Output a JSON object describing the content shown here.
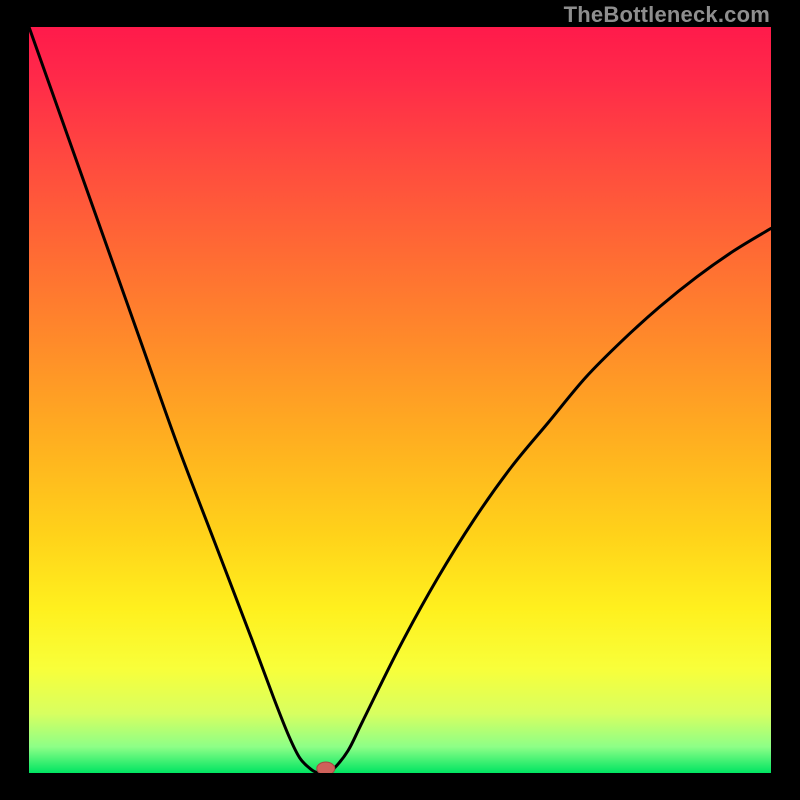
{
  "watermark": "TheBottleneck.com",
  "colors": {
    "frame": "#000000",
    "curve": "#000000",
    "marker_fill": "#cf615a",
    "marker_stroke": "#a64741"
  },
  "chart_data": {
    "type": "line",
    "title": "",
    "xlabel": "",
    "ylabel": "",
    "xlim": [
      0,
      100
    ],
    "ylim": [
      0,
      100
    ],
    "x": [
      0,
      5,
      10,
      15,
      20,
      25,
      30,
      33,
      35,
      36.5,
      38,
      39,
      40,
      41,
      43,
      45,
      50,
      55,
      60,
      65,
      70,
      75,
      80,
      85,
      90,
      95,
      100
    ],
    "values": [
      100,
      86,
      72,
      58,
      44,
      31,
      18,
      10,
      5,
      2,
      0.5,
      0,
      0,
      0.5,
      3,
      7,
      17,
      26,
      34,
      41,
      47,
      53,
      58,
      62.5,
      66.5,
      70,
      73
    ],
    "baseline_band_top_pct": 3.0,
    "marker": {
      "x_pct": 40.0,
      "y_pct": 0.6
    },
    "gradient_stops": [
      {
        "offset": 0,
        "color": "#ff1a4b"
      },
      {
        "offset": 0.07,
        "color": "#ff2a49"
      },
      {
        "offset": 0.18,
        "color": "#ff4a3f"
      },
      {
        "offset": 0.3,
        "color": "#ff6a34"
      },
      {
        "offset": 0.42,
        "color": "#ff8a2a"
      },
      {
        "offset": 0.55,
        "color": "#ffae20"
      },
      {
        "offset": 0.68,
        "color": "#ffd21a"
      },
      {
        "offset": 0.78,
        "color": "#fff01e"
      },
      {
        "offset": 0.86,
        "color": "#f8ff3a"
      },
      {
        "offset": 0.92,
        "color": "#d8ff60"
      },
      {
        "offset": 0.965,
        "color": "#8dff87"
      },
      {
        "offset": 1.0,
        "color": "#00e562"
      }
    ]
  }
}
